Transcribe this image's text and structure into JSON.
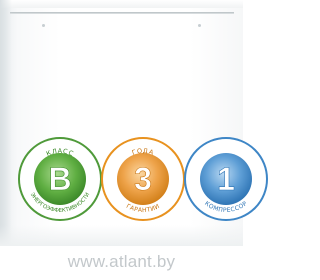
{
  "badges": [
    {
      "id": "energy-class",
      "symbol": "B",
      "top_text": "КЛАСС",
      "bottom_text": "ЭНЕРГОЭФФЕКТИВНОСТИ",
      "color": "#4f9a3a",
      "icon": "energy-class-b-icon"
    },
    {
      "id": "warranty",
      "symbol": "3",
      "top_text": "ГОДА",
      "bottom_text": "ГАРАНТИИ",
      "color": "#e8921f",
      "icon": "warranty-3-years-icon"
    },
    {
      "id": "compressor",
      "symbol": "1",
      "top_text": "",
      "bottom_text": "КОМПРЕССОР",
      "color": "#3e86c6",
      "icon": "one-compressor-icon"
    }
  ],
  "website": "www.atlant.by"
}
